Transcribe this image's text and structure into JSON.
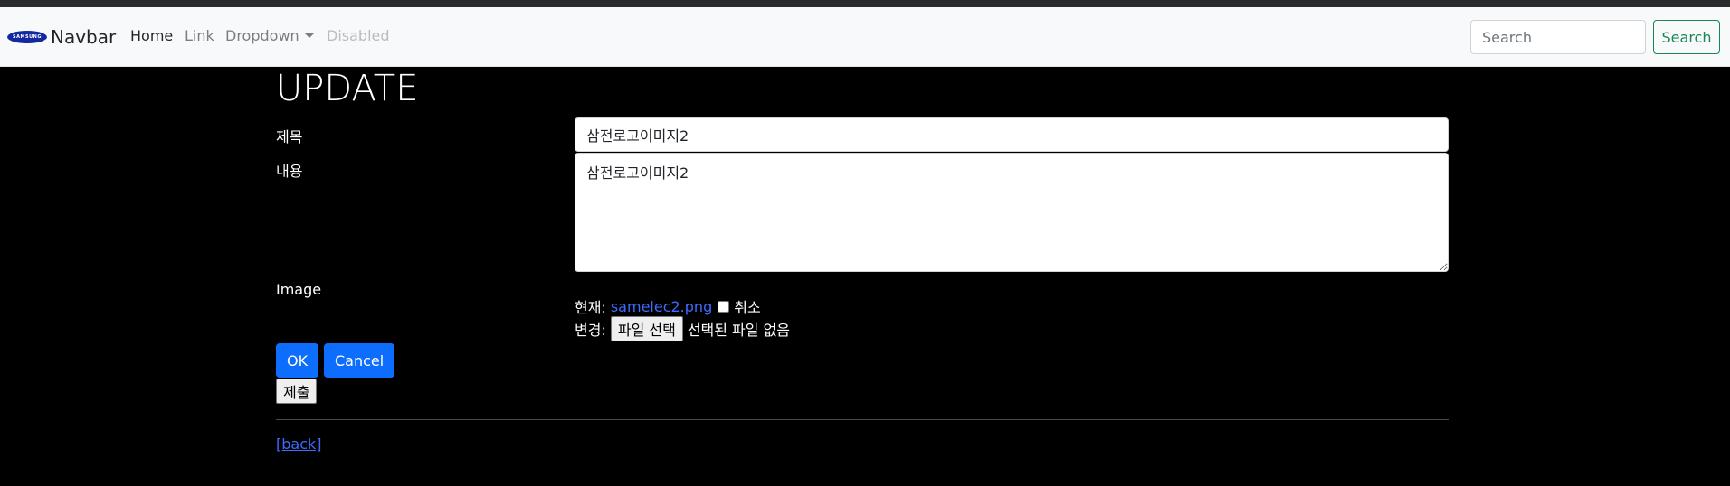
{
  "navbar": {
    "brand": "Navbar",
    "logo_text": "SAMSUNG",
    "links": {
      "home": "Home",
      "link": "Link",
      "dropdown": "Dropdown",
      "disabled": "Disabled"
    },
    "search": {
      "placeholder": "Search",
      "button": "Search"
    }
  },
  "form": {
    "heading": "UPDATE",
    "title_label": "제목",
    "title_value": "삼전로고이미지2",
    "content_label": "내용",
    "content_value": "삼전로고이미지2",
    "image_label": "Image",
    "current_label": "현재:",
    "current_file": "samelec2.png",
    "cancel_checkbox_label": "취소",
    "change_label": "변경:",
    "file_button": "파일 선택",
    "file_status": "선택된 파일 없음",
    "ok_button": "OK",
    "cancel_button": "Cancel",
    "submit_button": "제출"
  },
  "footer": {
    "back_link": "[back]"
  },
  "colors": {
    "primary": "#0d6efd",
    "success": "#198754",
    "background": "#000000",
    "navbar_bg": "#f8f9fa"
  }
}
